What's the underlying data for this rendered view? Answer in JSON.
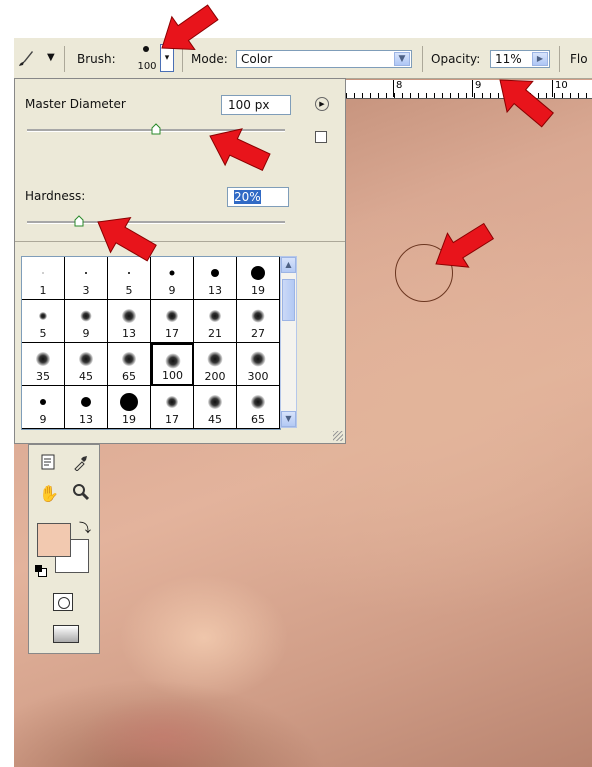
{
  "toolbar": {
    "brush_label": "Brush:",
    "brush_size": "100",
    "mode_label": "Mode:",
    "mode_value": "Color",
    "opacity_label": "Opacity:",
    "opacity_value": "11%",
    "flow_label": "Flo"
  },
  "ruler": {
    "marks": [
      "8",
      "9",
      "10"
    ]
  },
  "brush_popup": {
    "master_diameter_label": "Master Diameter",
    "master_diameter_value": "100 px",
    "master_diameter_slider": 0.5,
    "hardness_label": "Hardness:",
    "hardness_value": "20%",
    "hardness_slider": 0.2,
    "presets": [
      [
        "1",
        "3",
        "5",
        "9",
        "13",
        "19"
      ],
      [
        "5",
        "9",
        "13",
        "17",
        "21",
        "27"
      ],
      [
        "35",
        "45",
        "65",
        "100",
        "200",
        "300"
      ],
      [
        "9",
        "13",
        "19",
        "17",
        "45",
        "65"
      ]
    ],
    "selected_preset": "100"
  },
  "colors": {
    "foreground": "#f2c9b0",
    "background": "#ffffff",
    "arrow": "#e8141b",
    "ui_bg": "#ece9d8",
    "selection": "#316ac5"
  },
  "icons": [
    "brush-icon",
    "chevron-down-icon",
    "flyout-menu-icon",
    "reset-icon",
    "notes-icon",
    "eyedropper-icon",
    "hand-icon",
    "zoom-icon",
    "swap-colors-icon",
    "default-colors-icon",
    "quick-mask-icon",
    "screen-mode-icon"
  ]
}
